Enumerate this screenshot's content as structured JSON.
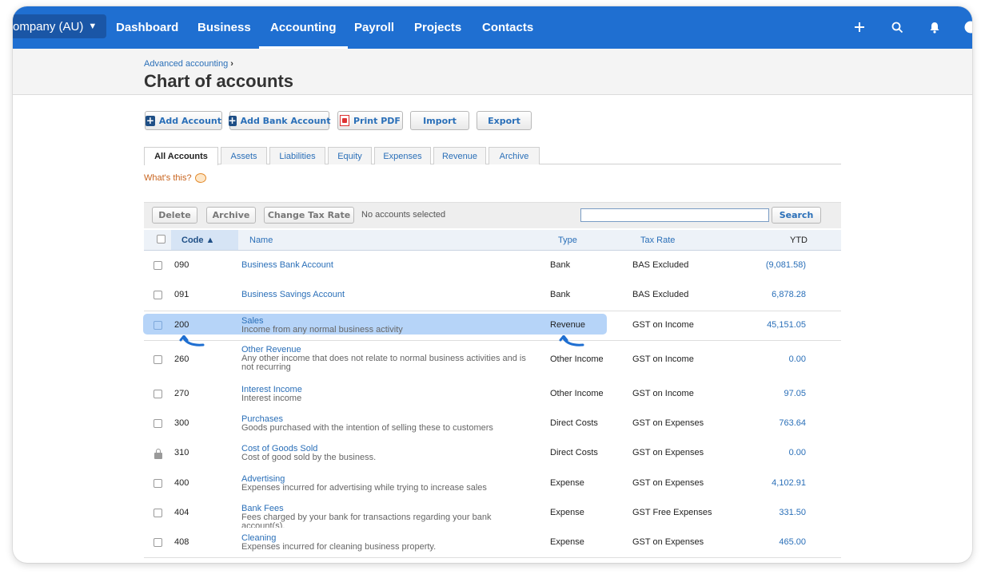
{
  "nav": {
    "org": "ompany (AU)",
    "items": [
      "Dashboard",
      "Business",
      "Accounting",
      "Payroll",
      "Projects",
      "Contacts"
    ],
    "active": "Accounting",
    "icons": [
      "plus-icon",
      "search-icon",
      "bell-icon",
      "help-icon"
    ]
  },
  "header": {
    "breadcrumb": "Advanced accounting",
    "breadcrumb_sep": "›",
    "title": "Chart of accounts"
  },
  "toolbar": {
    "add_account": "Add Account",
    "add_bank_account": "Add Bank Account",
    "print_pdf": "Print PDF",
    "import": "Import",
    "export": "Export"
  },
  "tabs": [
    "All Accounts",
    "Assets",
    "Liabilities",
    "Equity",
    "Expenses",
    "Revenue",
    "Archive"
  ],
  "whats_this": "What's this?",
  "actions": {
    "delete": "Delete",
    "archive": "Archive",
    "change_tax_rate": "Change Tax Rate",
    "no_selection": "No accounts selected",
    "search_value": "",
    "search_button": "Search"
  },
  "columns": {
    "code": "Code ▲",
    "name": "Name",
    "type": "Type",
    "tax_rate": "Tax Rate",
    "ytd": "YTD"
  },
  "rows": [
    {
      "code": "090",
      "name": "Business Bank Account",
      "desc": "",
      "type": "Bank",
      "tax": "BAS Excluded",
      "ytd": "(9,081.58)"
    },
    {
      "code": "091",
      "name": "Business Savings Account",
      "desc": "",
      "type": "Bank",
      "tax": "BAS Excluded",
      "ytd": "6,878.28"
    },
    {
      "code": "200",
      "name": "Sales",
      "desc": "Income from any normal business activity",
      "type": "Revenue",
      "tax": "GST on Income",
      "ytd": "45,151.05"
    },
    {
      "code": "260",
      "name": "Other Revenue",
      "desc": "Any other income that does not relate to normal business activities and is not recurring",
      "type": "Other Income",
      "tax": "GST on Income",
      "ytd": "0.00"
    },
    {
      "code": "270",
      "name": "Interest Income",
      "desc": "Interest income",
      "type": "Other Income",
      "tax": "GST on Income",
      "ytd": "97.05"
    },
    {
      "code": "300",
      "name": "Purchases",
      "desc": "Goods purchased with the intention of selling these to customers",
      "type": "Direct Costs",
      "tax": "GST on Expenses",
      "ytd": "763.64"
    },
    {
      "code": "310",
      "name": "Cost of Goods Sold",
      "desc": "Cost of good sold by the business.",
      "type": "Direct Costs",
      "tax": "GST on Expenses",
      "ytd": "0.00"
    },
    {
      "code": "400",
      "name": "Advertising",
      "desc": "Expenses incurred for advertising while trying to increase sales",
      "type": "Expense",
      "tax": "GST on Expenses",
      "ytd": "4,102.91"
    },
    {
      "code": "404",
      "name": "Bank Fees",
      "desc": "Fees charged by your bank for transactions regarding your bank account(s).",
      "type": "Expense",
      "tax": "GST Free Expenses",
      "ytd": "331.50"
    },
    {
      "code": "408",
      "name": "Cleaning",
      "desc": "Expenses incurred for cleaning business property.",
      "type": "Expense",
      "tax": "GST on Expenses",
      "ytd": "465.00"
    }
  ]
}
